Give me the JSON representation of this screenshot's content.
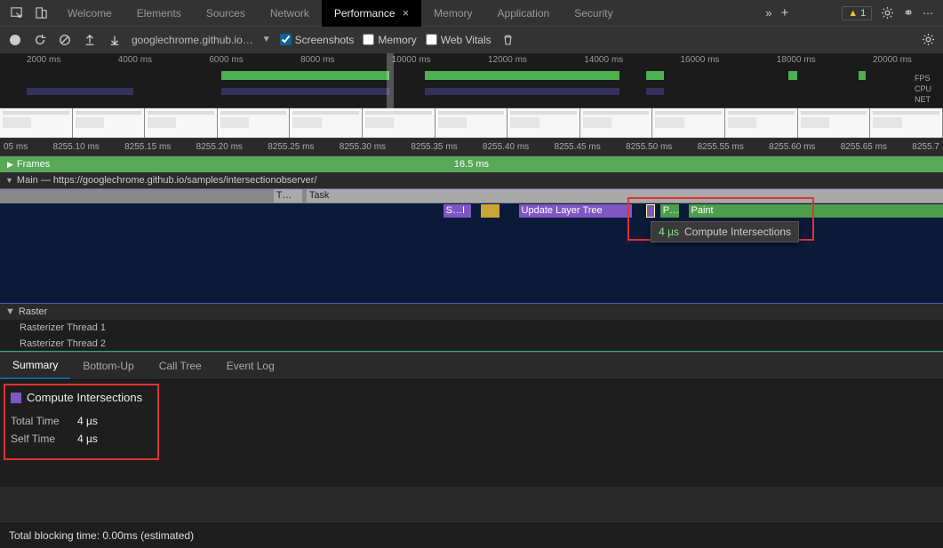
{
  "tabs": {
    "items": [
      "Welcome",
      "Elements",
      "Sources",
      "Network",
      "Performance",
      "Memory",
      "Application",
      "Security"
    ],
    "active_index": 4,
    "warn_count": "1"
  },
  "toolbar": {
    "host": "googlechrome.github.io…",
    "screenshots": "Screenshots",
    "memory": "Memory",
    "webvitals": "Web Vitals"
  },
  "overview": {
    "ticks": [
      "2000 ms",
      "4000 ms",
      "6000 ms",
      "8000 ms",
      "10000 ms",
      "12000 ms",
      "14000 ms",
      "16000 ms",
      "18000 ms",
      "20000 ms"
    ],
    "side": {
      "fps": "FPS",
      "cpu": "CPU",
      "net": "NET"
    }
  },
  "detail_ruler": [
    "05 ms",
    "8255.10 ms",
    "8255.15 ms",
    "8255.20 ms",
    "8255.25 ms",
    "8255.30 ms",
    "8255.35 ms",
    "8255.40 ms",
    "8255.45 ms",
    "8255.50 ms",
    "8255.55 ms",
    "8255.60 ms",
    "8255.65 ms",
    "8255.7"
  ],
  "frames": {
    "label": "Frames",
    "mid": "16.5 ms"
  },
  "main": {
    "header": "Main — https://googlechrome.github.io/samples/intersectionobserver/",
    "task1": "T…",
    "task2": "Task",
    "seg_si": "S…I",
    "seg_update": "Update Layer Tree",
    "seg_p": "P…",
    "seg_paint": "Paint"
  },
  "tooltip": {
    "dur": "4 µs",
    "name": "Compute Intersections"
  },
  "raster": {
    "header": "Raster",
    "r1": "Rasterizer Thread 1",
    "r2": "Rasterizer Thread 2"
  },
  "bottom_tabs": {
    "items": [
      "Summary",
      "Bottom-Up",
      "Call Tree",
      "Event Log"
    ],
    "active_index": 0
  },
  "summary": {
    "title": "Compute Intersections",
    "total_label": "Total Time",
    "total_val": "4 µs",
    "self_label": "Self Time",
    "self_val": "4 µs"
  },
  "footer": "Total blocking time: 0.00ms (estimated)"
}
